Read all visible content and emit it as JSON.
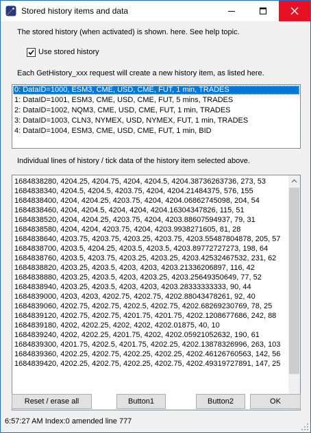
{
  "window": {
    "title": "Stored history items and data"
  },
  "header": {
    "info_text": "The stored history (when activated) is shown. here.  See help topic.",
    "use_stored_history_label": "Use stored history",
    "use_stored_history_checked": true,
    "request_info_text": "Each GetHistory_xxx  request will create a new history item, as listed here."
  },
  "history_items": [
    "0: DataID=1000, ESM3, CME, USD, CME, FUT, 1 min, TRADES",
    "1: DataID=1001, ESM3, CME, USD, CME, FUT, 5 mins, TRADES",
    "2: DataID=1002, NQM3, CME, USD, CME, FUT, 1 min, TRADES",
    "3: DataID=1003, CLN3, NYMEX, USD, NYMEX, FUT, 1 min, TRADES",
    "4: DataID=1004, ESM3, CME, USD, CME, FUT, 1 min, BID"
  ],
  "selected_index": 0,
  "lines_label": "Individual lines of history / tick data of the history item selected above.",
  "data_lines": [
    "1684838280, 4204.25, 4204.75, 4204, 4204.5, 4204.38736263736, 273, 53",
    "1684838340, 4204.5, 4204.5, 4203.75, 4204, 4204.21484375, 576, 155",
    "1684838400, 4204, 4204.25, 4203.75, 4204, 4204.06862745098, 204, 54",
    "1684838460, 4204, 4204.5, 4204, 4204, 4204.16304347826, 115, 51",
    "1684838520, 4204, 4204.25, 4203.75, 4204, 4203.88607594937, 79, 31",
    "1684838580, 4204, 4204, 4203.75, 4204, 4203.9938271605, 81, 28",
    "1684838640, 4203.75, 4203.75, 4203.25, 4203.75, 4203.55487804878, 205, 57",
    "1684838700, 4203.5, 4204.25, 4203.5, 4203.5, 4203.89772727273, 198, 64",
    "1684838760, 4203.5, 4203.75, 4203.25, 4203.25, 4203.42532467532, 231, 62",
    "1684838820, 4203.25, 4203.5, 4203, 4203, 4203.21336206897, 116, 42",
    "1684838880, 4203.25, 4203.5, 4203, 4203.25, 4203.25649350649, 77, 52",
    "1684838940, 4203.25, 4203.5, 4203, 4203, 4203.28333333333, 90, 44",
    "1684839000, 4203, 4203, 4202.75, 4202.75, 4202.88043478261, 92, 40",
    "1684839060, 4202.75, 4202.75, 4202.5, 4202.75, 4202.68269230769, 78, 25",
    "1684839120, 4202.75, 4202.75, 4201.75, 4201.75, 4202.1208677686, 242, 88",
    "1684839180, 4202, 4202.25, 4202, 4202, 4202.01875, 40, 10",
    "1684839240, 4202, 4202.25, 4201.75, 4202, 4202.05921052632, 190, 61",
    "1684839300, 4201.75, 4202.5, 4201.75, 4202.25, 4202.13878326996, 263, 103",
    "1684839360, 4202.25, 4202.75, 4202.25, 4202.25, 4202.46126760563, 142, 56",
    "1684839420, 4202.25, 4202.75, 4202.25, 4202.75, 4202.49319727891, 147, 25"
  ],
  "buttons": {
    "reset": "Reset / erase all",
    "button1": "Button1",
    "button2": "Button2",
    "ok": "OK"
  },
  "status": {
    "text": "6:57:27 AM Index:0 amended line 777"
  },
  "colors": {
    "selection": "#0078d7",
    "close_button": "#e81123",
    "window_border": "#1c6fc4"
  }
}
